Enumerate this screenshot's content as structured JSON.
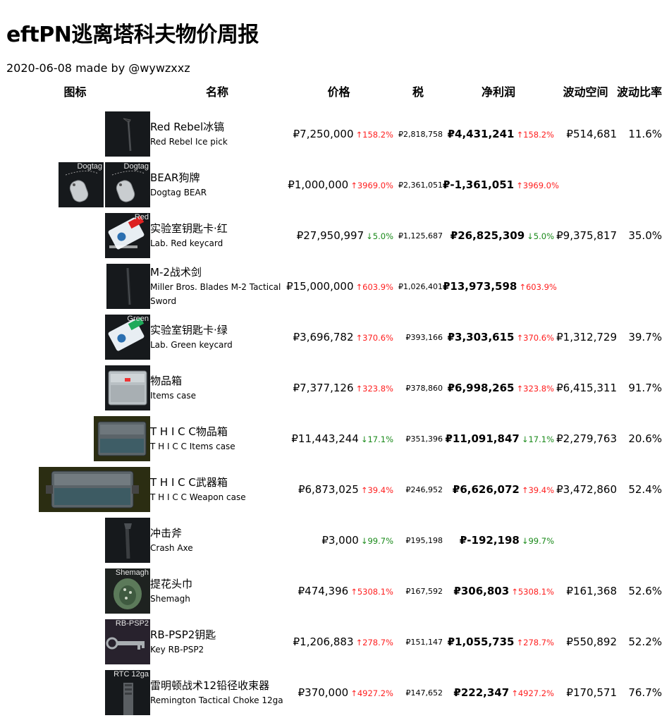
{
  "title": "eftPN逃离塔科夫物价周报",
  "subtitle": "2020-06-08 made by @wywzxxz",
  "headers": {
    "icon": "图标",
    "name": "名称",
    "price": "价格",
    "tax": "税",
    "profit": "净利润",
    "range": "波动空间",
    "ratio": "波动比率"
  },
  "colors": {
    "up": "#ff2020",
    "down": "#1a8a1a",
    "icon_bg": "#16191c"
  },
  "rows": [
    {
      "cn": "Red Rebel冰镐",
      "en": "Red Rebel Ice pick",
      "price": "₽7,250,000",
      "price_chg": "↑158.2%",
      "tax": "₽2,818,758",
      "profit": "₽4,431,241",
      "profit_chg": "↑158.2%",
      "range": "₽514,681",
      "ratio": "11.6%",
      "icon": "ice-pick-icon"
    },
    {
      "cn": "BEAR狗牌",
      "en": "Dogtag BEAR",
      "price": "₽1,000,000",
      "price_chg": "↑3969.0%",
      "tax": "₽2,361,051",
      "profit": "₽-1,361,051",
      "profit_chg": "↑3969.0%",
      "range": "",
      "ratio": "",
      "icon": "dogtag-icon",
      "icon_labels": [
        "Dogtag",
        "Dogtag"
      ]
    },
    {
      "cn": "实验室钥匙卡·红",
      "en": "Lab. Red keycard",
      "price": "₽27,950,997",
      "price_chg": "↓5.0%",
      "tax": "₽1,125,687",
      "profit": "₽26,825,309",
      "profit_chg": "↓5.0%",
      "range": "₽9,375,817",
      "ratio": "35.0%",
      "icon": "red-keycard-icon",
      "icon_label": "Red"
    },
    {
      "cn": "M-2战术剑",
      "en": "Miller Bros. Blades M-2 Tactical Sword",
      "price": "₽15,000,000",
      "price_chg": "↑603.9%",
      "tax": "₽1,026,401",
      "profit": "₽13,973,598",
      "profit_chg": "↑603.9%",
      "range": "",
      "ratio": "",
      "icon": "sword-icon"
    },
    {
      "cn": "实验室钥匙卡·绿",
      "en": "Lab. Green keycard",
      "price": "₽3,696,782",
      "price_chg": "↑370.6%",
      "tax": "₽393,166",
      "profit": "₽3,303,615",
      "profit_chg": "↑370.6%",
      "range": "₽1,312,729",
      "ratio": "39.7%",
      "icon": "green-keycard-icon",
      "icon_label": "Green"
    },
    {
      "cn": "物品箱",
      "en": "Items case",
      "price": "₽7,377,126",
      "price_chg": "↑323.8%",
      "tax": "₽378,860",
      "profit": "₽6,998,265",
      "profit_chg": "↑323.8%",
      "range": "₽6,415,311",
      "ratio": "91.7%",
      "icon": "items-case-icon"
    },
    {
      "cn": "T H I C C物品箱",
      "en": "T H I C C Items case",
      "price": "₽11,443,244",
      "price_chg": "↓17.1%",
      "tax": "₽351,396",
      "profit": "₽11,091,847",
      "profit_chg": "↓17.1%",
      "range": "₽2,279,763",
      "ratio": "20.6%",
      "icon": "thicc-items-case-icon"
    },
    {
      "cn": "T H I C C武器箱",
      "en": "T H I C C Weapon case",
      "price": "₽6,873,025",
      "price_chg": "↑39.4%",
      "tax": "₽246,952",
      "profit": "₽6,626,072",
      "profit_chg": "↑39.4%",
      "range": "₽3,472,860",
      "ratio": "52.4%",
      "icon": "thicc-weapon-case-icon"
    },
    {
      "cn": "冲击斧",
      "en": "Crash Axe",
      "price": "₽3,000",
      "price_chg": "↓99.7%",
      "tax": "₽195,198",
      "profit": "₽-192,198",
      "profit_chg": "↓99.7%",
      "range": "",
      "ratio": "",
      "icon": "axe-icon"
    },
    {
      "cn": "提花头巾",
      "en": "Shemagh",
      "price": "₽474,396",
      "price_chg": "↑5308.1%",
      "tax": "₽167,592",
      "profit": "₽306,803",
      "profit_chg": "↑5308.1%",
      "range": "₽161,368",
      "ratio": "52.6%",
      "icon": "shemagh-icon",
      "icon_label": "Shemagh"
    },
    {
      "cn": "RB-PSP2钥匙",
      "en": "Key RB-PSP2",
      "price": "₽1,206,883",
      "price_chg": "↑278.7%",
      "tax": "₽151,147",
      "profit": "₽1,055,735",
      "profit_chg": "↑278.7%",
      "range": "₽550,892",
      "ratio": "52.2%",
      "icon": "key-icon",
      "icon_label": "RB-PSP2"
    },
    {
      "cn": "雷明顿战术12铅径收束器",
      "en": "Remington Tactical Choke 12ga",
      "price": "₽370,000",
      "price_chg": "↑4927.2%",
      "tax": "₽147,652",
      "profit": "₽222,347",
      "profit_chg": "↑4927.2%",
      "range": "₽170,571",
      "ratio": "76.7%",
      "icon": "choke-icon",
      "icon_label": "RTC 12ga"
    }
  ]
}
